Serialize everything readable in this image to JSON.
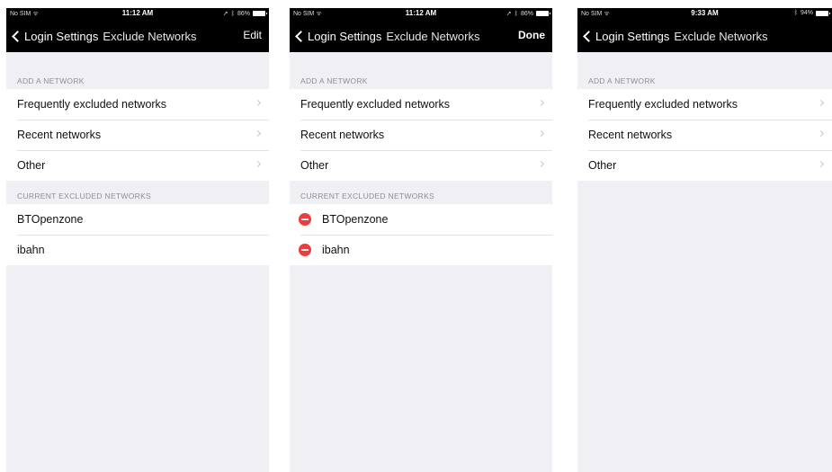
{
  "screens": [
    {
      "status": {
        "carrier": "No SIM",
        "time": "11:12 AM",
        "battery": "86%"
      },
      "nav": {
        "back_label": "Login Settings",
        "title": "Exclude Networks",
        "action": "Edit"
      },
      "add_header": "ADD A NETWORK",
      "add_items": [
        "Frequently excluded networks",
        "Recent networks",
        "Other"
      ],
      "current_header": "CURRENT EXCLUDED NETWORKS",
      "current_items": [
        "BTOpenzone",
        "ibahn"
      ]
    },
    {
      "status": {
        "carrier": "No SIM",
        "time": "11:12 AM",
        "battery": "86%"
      },
      "nav": {
        "back_label": "Login Settings",
        "title": "Exclude Networks",
        "action": "Done"
      },
      "add_header": "ADD A NETWORK",
      "add_items": [
        "Frequently excluded networks",
        "Recent networks",
        "Other"
      ],
      "current_header": "CURRENT EXCLUDED NETWORKS",
      "current_items": [
        "BTOpenzone",
        "ibahn"
      ]
    },
    {
      "status": {
        "carrier": "No SIM",
        "time": "9:33 AM",
        "battery": "94%"
      },
      "nav": {
        "back_label": "Login Settings",
        "title": "Exclude Networks",
        "action": ""
      },
      "add_header": "ADD A NETWORK",
      "add_items": [
        "Frequently excluded networks",
        "Recent networks",
        "Other"
      ]
    }
  ],
  "colors": {
    "navbar": "#000000",
    "background": "#efeff4",
    "delete": "#ee3b3b"
  }
}
